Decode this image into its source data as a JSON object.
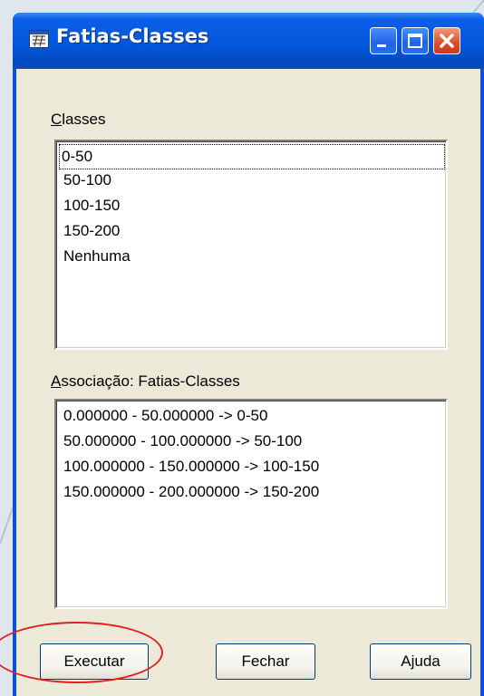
{
  "window": {
    "title": "Fatias-Classes",
    "icons": {
      "app": "grid-app-icon",
      "minimize": "minimize-icon",
      "maximize": "maximize-icon",
      "close": "close-icon"
    }
  },
  "classes": {
    "label_access": "C",
    "label_rest": "lasses",
    "items": [
      "0-50",
      "50-100",
      "100-150",
      "150-200",
      "Nenhuma"
    ]
  },
  "association": {
    "label_access": "A",
    "label_rest": "ssociação: Fatias-Classes",
    "items": [
      "0.000000 - 50.000000 -> 0-50",
      "50.000000 - 100.000000 -> 50-100",
      "100.000000 - 150.000000 -> 100-150",
      "150.000000 - 200.000000 -> 150-200"
    ]
  },
  "buttons": {
    "execute": "Executar",
    "close": "Fechar",
    "help": "Ajuda"
  },
  "colors": {
    "title_bar": "#0356d8",
    "close_button": "#e0502c",
    "dialog_bg": "#ece9d8",
    "highlight_ellipse": "#e02020"
  }
}
